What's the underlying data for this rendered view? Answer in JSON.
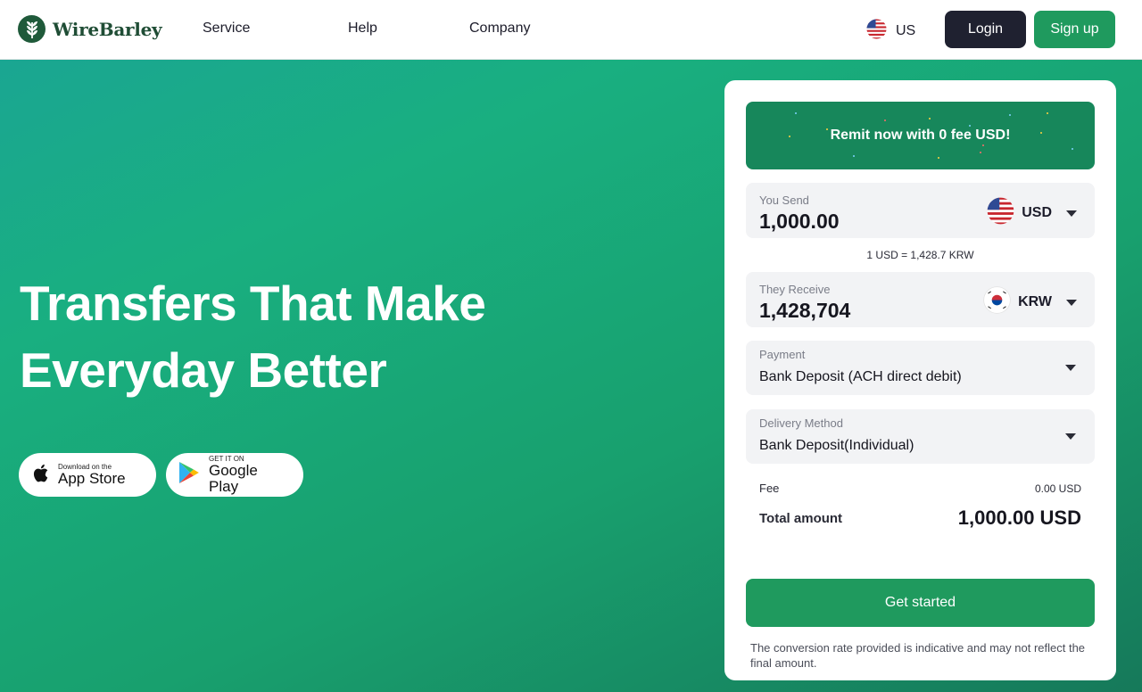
{
  "header": {
    "brand": "WireBarley",
    "nav": [
      "Service",
      "Help",
      "Company"
    ],
    "locale": "US",
    "login_label": "Login",
    "signup_label": "Sign up"
  },
  "hero": {
    "title_line1": "Transfers That Make",
    "title_line2": "Everyday Better",
    "app_store": {
      "small": "Download on the",
      "big": "App Store"
    },
    "google_play": {
      "small": "GET IT ON",
      "big": "Google Play"
    }
  },
  "calculator": {
    "promo": "Remit now with 0 fee USD!",
    "send": {
      "label": "You Send",
      "amount": "1,000.00",
      "currency": "USD"
    },
    "rate": "1 USD = 1,428.7 KRW",
    "receive": {
      "label": "They Receive",
      "amount": "1,428,704",
      "currency": "KRW"
    },
    "payment": {
      "label": "Payment",
      "value": "Bank Deposit (ACH direct debit)"
    },
    "delivery": {
      "label": "Delivery Method",
      "value": "Bank Deposit(Individual)"
    },
    "fee": {
      "label": "Fee",
      "value": "0.00 USD"
    },
    "total": {
      "label": "Total amount",
      "value": "1,000.00 USD"
    },
    "cta": "Get started",
    "disclaimer": "The conversion rate provided is indicative and may not reflect the final amount."
  },
  "colors": {
    "brand_green": "#1f9a5e",
    "dark_button": "#1f2130",
    "hero_gradient_start": "#1aa692",
    "hero_gradient_end": "#16795a"
  },
  "icons": [
    "wheat-logo-icon",
    "us-flag-icon",
    "kr-flag-icon",
    "apple-icon",
    "google-play-icon",
    "chevron-down-icon"
  ]
}
